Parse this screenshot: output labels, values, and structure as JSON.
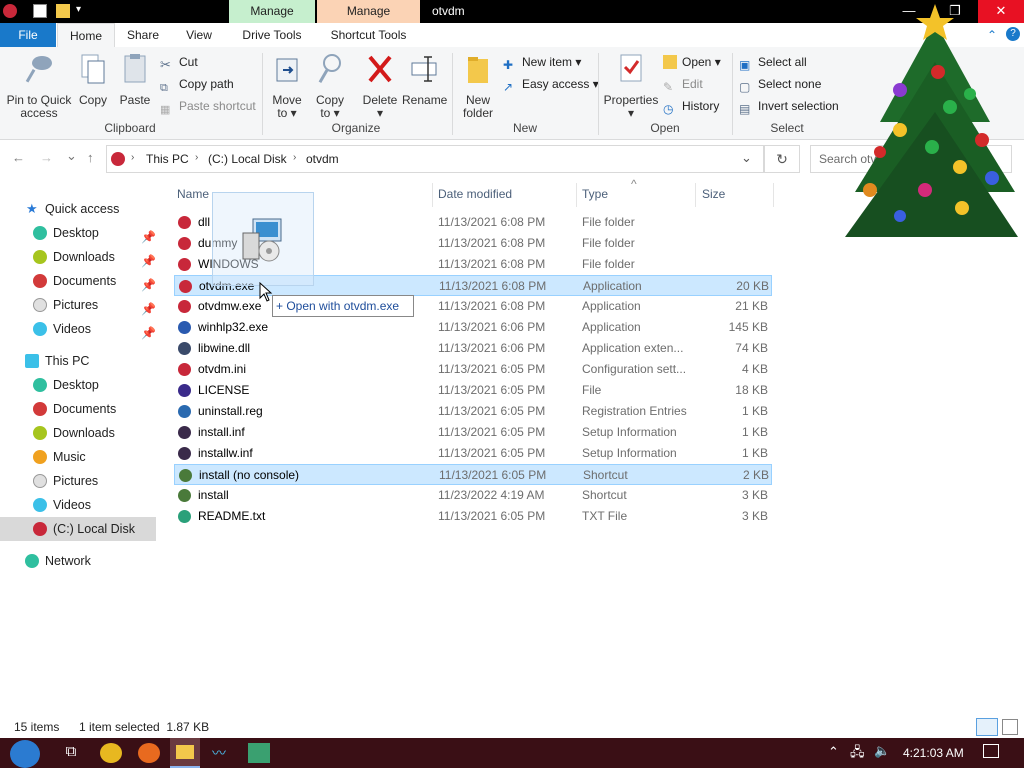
{
  "titlebar": {
    "title": "otvdm",
    "ctx_tab_1": "Manage",
    "ctx_tab_2": "Manage",
    "minimize": "—",
    "maximize": "❐",
    "close": "✕"
  },
  "tabs": {
    "file": "File",
    "home": "Home",
    "share": "Share",
    "view": "View",
    "drive_tools": "Drive Tools",
    "shortcut_tools": "Shortcut Tools"
  },
  "ribbon": {
    "clipboard": {
      "label": "Clipboard",
      "pin_l1": "Pin to Quick",
      "pin_l2": "access",
      "copy": "Copy",
      "paste": "Paste",
      "cut": "Cut",
      "copy_path": "Copy path",
      "paste_shortcut": "Paste shortcut"
    },
    "organize": {
      "label": "Organize",
      "move_l1": "Move",
      "move_l2": "to ▾",
      "copy_l1": "Copy",
      "copy_l2": "to ▾",
      "delete_l1": "Delete",
      "delete_l2": "▾",
      "rename": "Rename"
    },
    "new": {
      "label": "New",
      "folder_l1": "New",
      "folder_l2": "folder",
      "new_item": "New item ▾",
      "easy_access": "Easy access ▾"
    },
    "open": {
      "label": "Open",
      "properties": "Properties",
      "properties_arrow": "▾",
      "open": "Open ▾",
      "edit": "Edit",
      "history": "History"
    },
    "select": {
      "label": "Select",
      "select_all": "Select all",
      "select_none": "Select none",
      "invert": "Invert selection"
    }
  },
  "address": {
    "back": "←",
    "forward": "→",
    "recent": "⌄",
    "up": "↑",
    "crumbs": [
      "This PC",
      "(C:) Local Disk",
      "otvdm"
    ],
    "dropdown": "⌄",
    "refresh": "↻",
    "search_placeholder": "Search otv"
  },
  "nav": {
    "quick_access": "Quick access",
    "qa_items": [
      "Desktop",
      "Downloads",
      "Documents",
      "Pictures",
      "Videos"
    ],
    "this_pc": "This PC",
    "pc_items": [
      "Desktop",
      "Documents",
      "Downloads",
      "Music",
      "Pictures",
      "Videos",
      "(C:) Local Disk"
    ],
    "network": "Network"
  },
  "columns": {
    "name": "Name",
    "date": "Date modified",
    "type": "Type",
    "size": "Size",
    "sort": "^"
  },
  "files": [
    {
      "name": "dll",
      "date": "11/13/2021 6:08 PM",
      "type": "File folder",
      "size": ""
    },
    {
      "name": "dummy",
      "date": "11/13/2021 6:08 PM",
      "type": "File folder",
      "size": ""
    },
    {
      "name": "WINDOWS",
      "date": "11/13/2021 6:08 PM",
      "type": "File folder",
      "size": ""
    },
    {
      "name": "otvdm.exe",
      "date": "11/13/2021 6:08 PM",
      "type": "Application",
      "size": "20 KB"
    },
    {
      "name": "otvdmw.exe",
      "date": "11/13/2021 6:08 PM",
      "type": "Application",
      "size": "21 KB"
    },
    {
      "name": "winhlp32.exe",
      "date": "11/13/2021 6:06 PM",
      "type": "Application",
      "size": "145 KB"
    },
    {
      "name": "libwine.dll",
      "date": "11/13/2021 6:06 PM",
      "type": "Application exten...",
      "size": "74 KB"
    },
    {
      "name": "otvdm.ini",
      "date": "11/13/2021 6:05 PM",
      "type": "Configuration sett...",
      "size": "4 KB"
    },
    {
      "name": "LICENSE",
      "date": "11/13/2021 6:05 PM",
      "type": "File",
      "size": "18 KB"
    },
    {
      "name": "uninstall.reg",
      "date": "11/13/2021 6:05 PM",
      "type": "Registration Entries",
      "size": "1 KB"
    },
    {
      "name": "install.inf",
      "date": "11/13/2021 6:05 PM",
      "type": "Setup Information",
      "size": "1 KB"
    },
    {
      "name": "installw.inf",
      "date": "11/13/2021 6:05 PM",
      "type": "Setup Information",
      "size": "1 KB"
    },
    {
      "name": "install (no console)",
      "date": "11/13/2021 6:05 PM",
      "type": "Shortcut",
      "size": "2 KB"
    },
    {
      "name": "install",
      "date": "11/23/2022 4:19 AM",
      "type": "Shortcut",
      "size": "3 KB"
    },
    {
      "name": "README.txt",
      "date": "11/13/2021 6:05 PM",
      "type": "TXT File",
      "size": "3 KB"
    }
  ],
  "tooltip": "+ Open with otvdm.exe",
  "status": {
    "items": "15 items",
    "selected": "1 item selected  1.87 KB"
  },
  "taskbar": {
    "time": "4:21:03 AM"
  },
  "colors": {
    "accent": "#1979ca",
    "manage_green": "#c6efce",
    "manage_orange": "#fbd3b5",
    "taskbar": "#3a0f15",
    "selection": "#cce8ff"
  }
}
